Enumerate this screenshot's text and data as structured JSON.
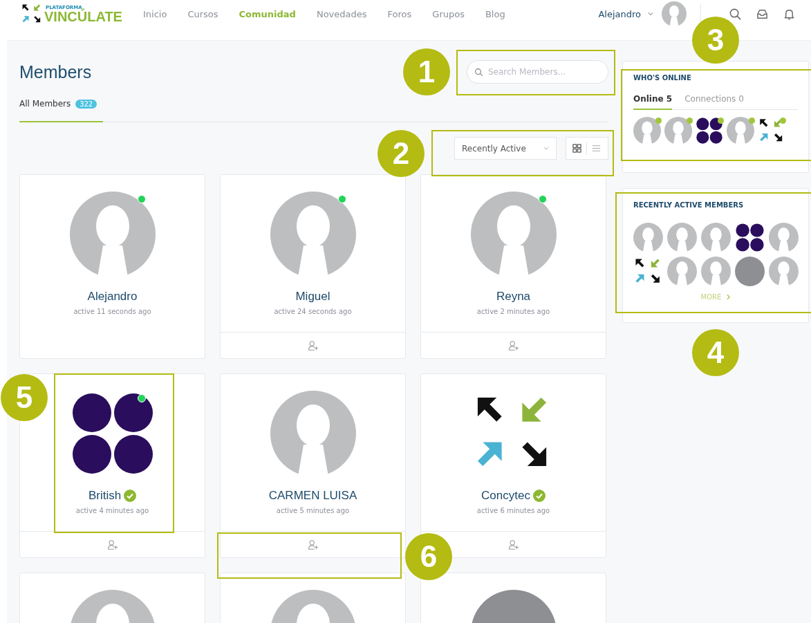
{
  "header": {
    "logo": {
      "small": "PLATAFORMA",
      "name": "VINCÚLATE"
    },
    "nav": [
      {
        "label": "Inicio",
        "selected": false
      },
      {
        "label": "Cursos",
        "selected": false
      },
      {
        "label": "Comunidad",
        "selected": true
      },
      {
        "label": "Novedades",
        "selected": false
      },
      {
        "label": "Foros",
        "selected": false
      },
      {
        "label": "Grupos",
        "selected": false
      },
      {
        "label": "Blog",
        "selected": false
      }
    ],
    "user": {
      "name": "Alejandro"
    }
  },
  "members": {
    "title": "Members",
    "search": {
      "placeholder": "Search Members..."
    },
    "tabs": [
      {
        "label": "All Members",
        "count": "322",
        "selected": true
      }
    ],
    "sort": {
      "value": "Recently Active"
    },
    "view": [
      {
        "kind": "grid",
        "selected": true
      },
      {
        "kind": "list",
        "selected": false
      }
    ],
    "cards": [
      {
        "name": "Alejandro",
        "activity": "active 11 seconds ago",
        "kind": "default",
        "online": true,
        "verified": false,
        "can_add": false
      },
      {
        "name": "Miguel",
        "activity": "active 24 seconds ago",
        "kind": "default",
        "online": true,
        "verified": false,
        "can_add": true
      },
      {
        "name": "Reyna",
        "activity": "active 2 minutes ago",
        "kind": "default",
        "online": true,
        "verified": false,
        "can_add": true
      },
      {
        "name": "British",
        "activity": "active 4 minutes ago",
        "kind": "dots",
        "online": true,
        "verified": true,
        "can_add": true
      },
      {
        "name": "CARMEN LUISA",
        "activity": "active 5 minutes ago",
        "kind": "default",
        "online": false,
        "verified": false,
        "can_add": true
      },
      {
        "name": "Concytec",
        "activity": "active 6 minutes ago",
        "kind": "logo",
        "online": false,
        "verified": true,
        "can_add": true
      },
      {
        "kind": "default",
        "online": false,
        "verified": false,
        "can_add": false
      },
      {
        "kind": "default",
        "online": false,
        "verified": false,
        "can_add": false
      },
      {
        "kind": "photo",
        "online": false,
        "verified": false,
        "can_add": false
      }
    ]
  },
  "sidebar": {
    "whos_online": {
      "title": "WHO'S ONLINE",
      "tabs": [
        {
          "label": "Online 5",
          "selected": true
        },
        {
          "label": "Connections 0",
          "selected": false
        }
      ],
      "avatars": [
        {
          "kind": "default",
          "online": true
        },
        {
          "kind": "default",
          "online": true
        },
        {
          "kind": "dots",
          "online": true
        },
        {
          "kind": "default",
          "online": true
        },
        {
          "kind": "logo",
          "online": true
        }
      ]
    },
    "recently_active": {
      "title": "RECENTLY ACTIVE MEMBERS",
      "avatars": [
        {
          "kind": "default"
        },
        {
          "kind": "default"
        },
        {
          "kind": "default"
        },
        {
          "kind": "dots"
        },
        {
          "kind": "default"
        },
        {
          "kind": "logo"
        },
        {
          "kind": "default"
        },
        {
          "kind": "default"
        },
        {
          "kind": "photo"
        },
        {
          "kind": "default"
        }
      ],
      "more": "MORE"
    }
  },
  "callouts": [
    {
      "number": "1"
    },
    {
      "number": "2"
    },
    {
      "number": "3"
    },
    {
      "number": "4"
    },
    {
      "number": "5"
    },
    {
      "number": "6"
    }
  ]
}
